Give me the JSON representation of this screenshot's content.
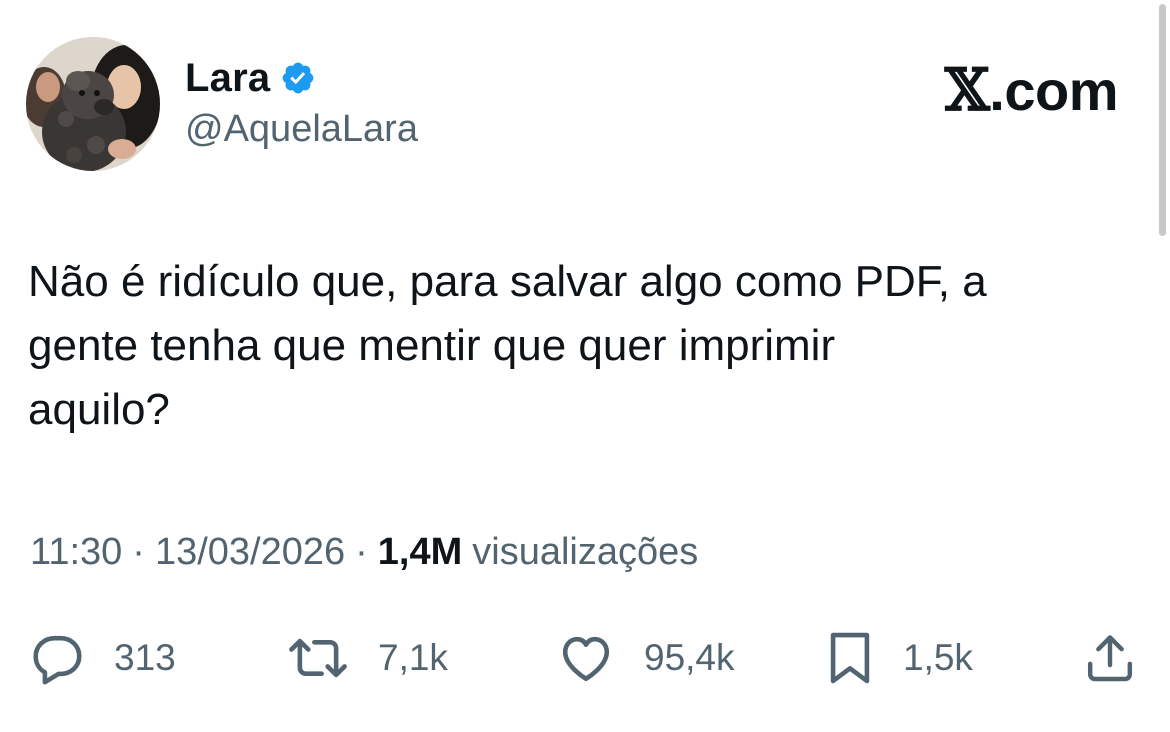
{
  "header": {
    "display_name": "Lara",
    "handle": "@AquelaLara",
    "brand": {
      "x_mark": "𝕏",
      "suffix": ".com"
    },
    "verified_icon": "verified-badge-icon",
    "accent_color": "#1d9bf0"
  },
  "tweet": {
    "text": "Não é ridículo que, para salvar algo como PDF, a\ngente tenha que mentir que quer imprimir\naquilo?"
  },
  "meta": {
    "time": "11:30",
    "separator": "·",
    "date": "13/03/2026",
    "views_count": "1,4M",
    "views_label": "visualizações"
  },
  "actions": {
    "reply": {
      "icon": "reply-icon",
      "count": "313"
    },
    "retweet": {
      "icon": "retweet-icon",
      "count": "7,1k"
    },
    "like": {
      "icon": "heart-icon",
      "count": "95,4k"
    },
    "bookmark": {
      "icon": "bookmark-icon",
      "count": "1,5k"
    },
    "share": {
      "icon": "share-icon"
    }
  },
  "colors": {
    "text_primary": "#0f1419",
    "text_secondary": "#536471",
    "background": "#ffffff"
  }
}
